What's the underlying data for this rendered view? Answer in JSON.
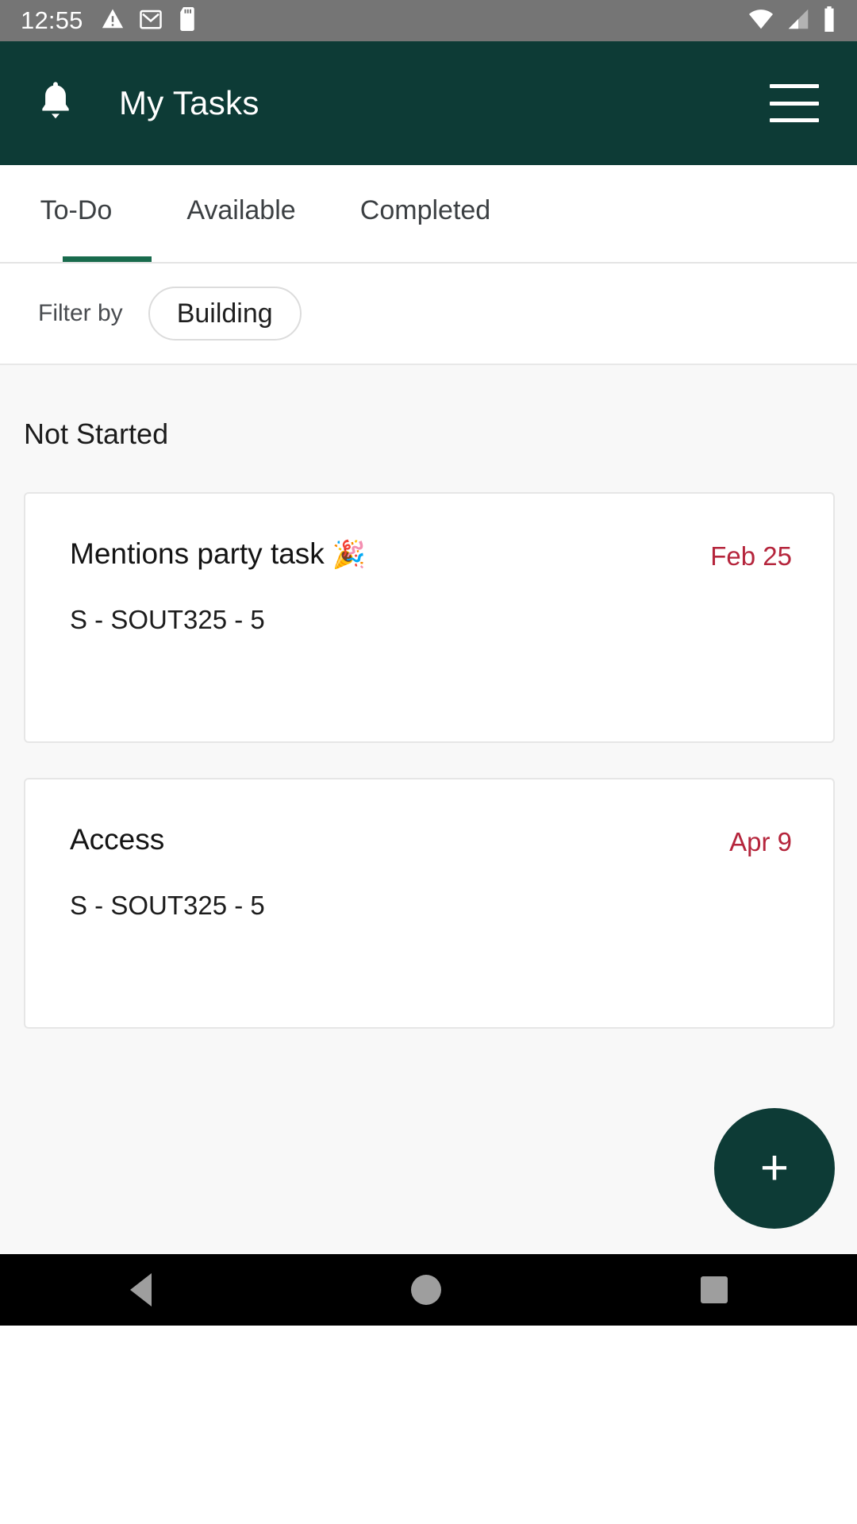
{
  "status_bar": {
    "clock": "12:55",
    "left_icons": [
      "warning-triangle-icon",
      "gmail-icon",
      "sd-card-icon"
    ],
    "right_icons": [
      "wifi-icon",
      "cellular-signal-icon",
      "battery-icon"
    ]
  },
  "app_bar": {
    "notification_icon": "bell-icon",
    "title": "My Tasks",
    "menu_icon": "hamburger-menu-icon"
  },
  "tabs": {
    "items": [
      {
        "label": "To-Do",
        "active": true
      },
      {
        "label": "Available",
        "active": false
      },
      {
        "label": "Completed",
        "active": false
      }
    ],
    "active_indicator_color": "#196b4d"
  },
  "filter": {
    "label": "Filter by",
    "chip_value": "Building"
  },
  "sections": [
    {
      "title": "Not Started",
      "cards": [
        {
          "title": "Mentions party task",
          "emoji": "🎉",
          "subtitle": "S - SOUT325 - 5",
          "date": "Feb 25"
        },
        {
          "title": "Access",
          "emoji": "",
          "subtitle": "S - SOUT325 - 5",
          "date": "Apr 9"
        }
      ]
    }
  ],
  "fab": {
    "label": "+",
    "icon": "plus-icon",
    "color": "#0d3b36"
  },
  "nav_bar": {
    "back": "back-triangle-icon",
    "home": "home-circle-icon",
    "recents": "recents-square-icon"
  },
  "colors": {
    "app_bar": "#0d3b36",
    "accent_green": "#196b4d",
    "due_date_red": "#b5253c",
    "content_bg": "#f8f8f8"
  }
}
